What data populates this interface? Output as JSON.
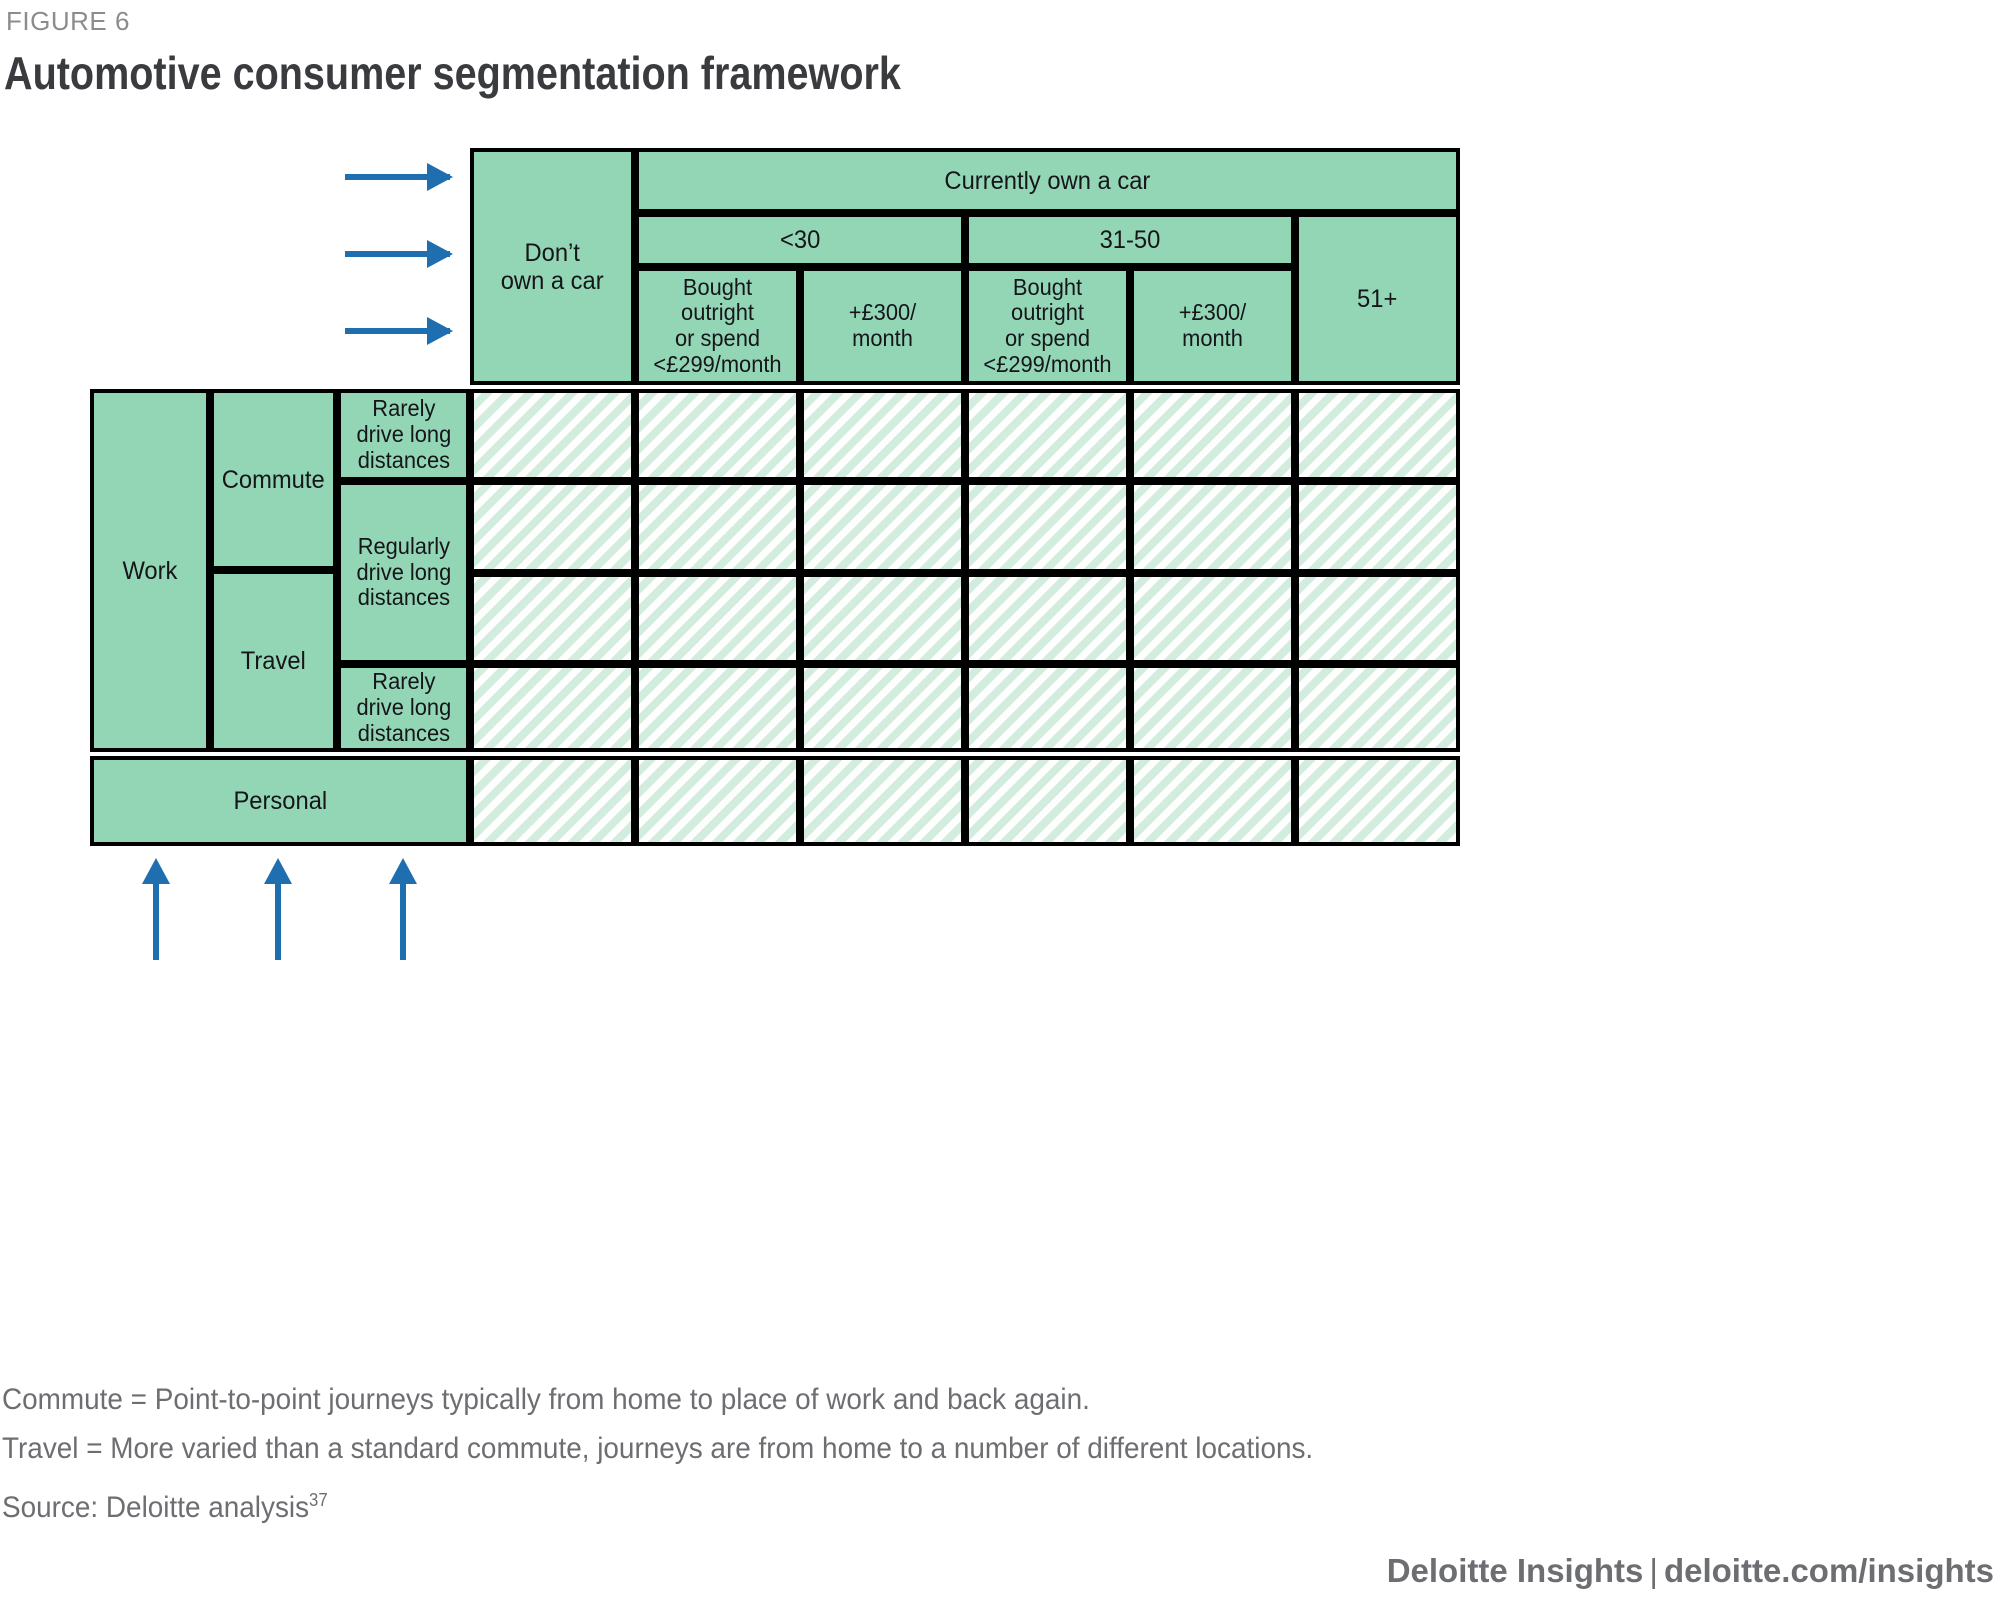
{
  "figure": {
    "label": "FIGURE 6",
    "title": "Automotive consumer segmentation framework"
  },
  "colors": {
    "header_fill": "#93d6b6",
    "cell_fill": "#e4f4ea",
    "arrow": "#1f6eb0",
    "title_text": "#3a3b3f",
    "note_text": "#6d6e71"
  },
  "matrix": {
    "column_headers": {
      "dont_own": "Don’t\nown a car",
      "dont_own_line1": "Don’t",
      "dont_own_line2": "own a car",
      "currently_own": "Currently own a car",
      "age_groups": [
        "<30",
        "31-50",
        "51+"
      ],
      "spend_under_30": "Bought outright\nor spend\n<£299/month",
      "spend_under_30_l1": "Bought outright",
      "spend_under_30_l2": "or spend",
      "spend_under_30_l3": "<£299/month",
      "spend_plus_30": "+£300/\nmonth",
      "spend_plus_30_l1": "+£300/",
      "spend_plus_30_l2": "month",
      "spend_under_31_50": "Bought outright\nor spend\n<£299/month",
      "spend_under_31_50_l1": "Bought outright",
      "spend_under_31_50_l2": "or spend",
      "spend_under_31_50_l3": "<£299/month",
      "spend_plus_31_50": "+£300/\nmonth",
      "spend_plus_31_50_l1": "+£300/",
      "spend_plus_31_50_l2": "month",
      "age_51_plus": "51+"
    },
    "row_headers": {
      "work": "Work",
      "commute": "Commute",
      "travel": "Travel",
      "personal": "Personal",
      "rarely_1_l1": "Rarely",
      "rarely_1_l2": "drive long",
      "rarely_1_l3": "distances",
      "regularly_l1": "Regularly",
      "regularly_l2": "drive long",
      "regularly_l3": "distances",
      "rarely_2_l1": "Rarely",
      "rarely_2_l2": "drive long",
      "rarely_2_l3": "distances"
    },
    "grid": {
      "data_columns": 6,
      "data_rows": 5
    }
  },
  "notes": {
    "commute": "Commute = Point-to-point journeys typically from home to place of work and back again.",
    "travel": "Travel = More varied than a standard commute, journeys are from home to a number of different locations.",
    "source_label": "Source: Deloitte analysis",
    "source_ref": "37"
  },
  "footer": {
    "brand": "Deloitte Insights",
    "separator": "|",
    "url": "deloitte.com/insights"
  }
}
